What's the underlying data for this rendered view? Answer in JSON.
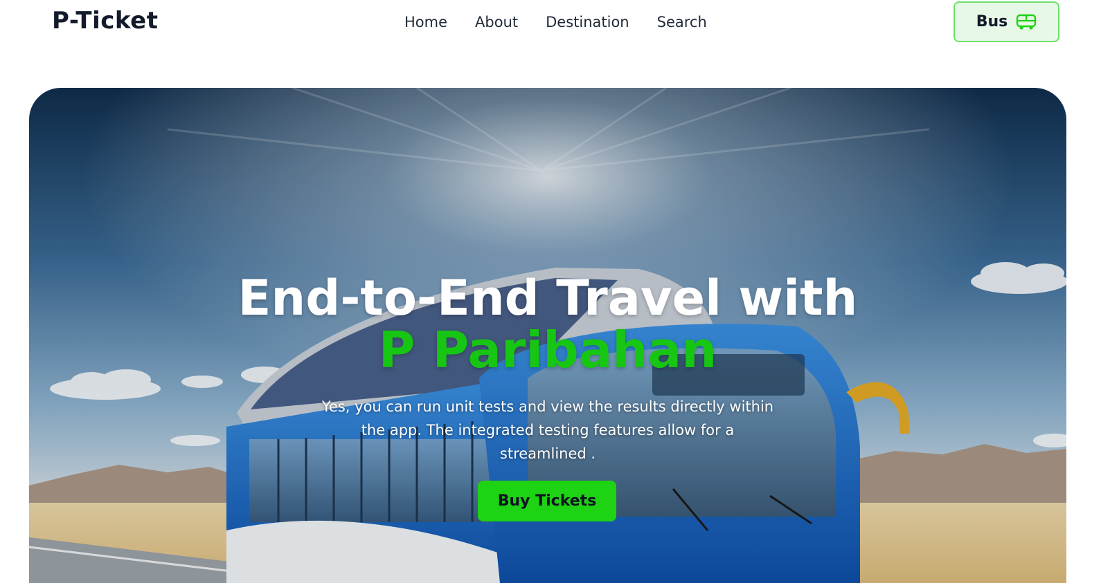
{
  "header": {
    "logo": "P-Ticket",
    "nav": [
      {
        "label": "Home"
      },
      {
        "label": "About"
      },
      {
        "label": "Destination"
      },
      {
        "label": "Search"
      }
    ],
    "bus_button": {
      "label": "Bus",
      "icon": "bus-icon"
    }
  },
  "hero": {
    "title_line1": "End-to-End Travel with",
    "title_highlight": "P Paribahan",
    "description": "Yes, you can run unit tests and view the results directly within the app. The integrated testing features allow for a streamlined .",
    "cta_label": "Buy Tickets",
    "background": "bus-on-desert-road-image"
  },
  "colors": {
    "accent_green": "#1ed214",
    "highlight_green": "#17c513",
    "bus_button_bg": "#e8f8e6",
    "bus_button_border": "#6ee06a",
    "dark_text": "#131a2b"
  }
}
